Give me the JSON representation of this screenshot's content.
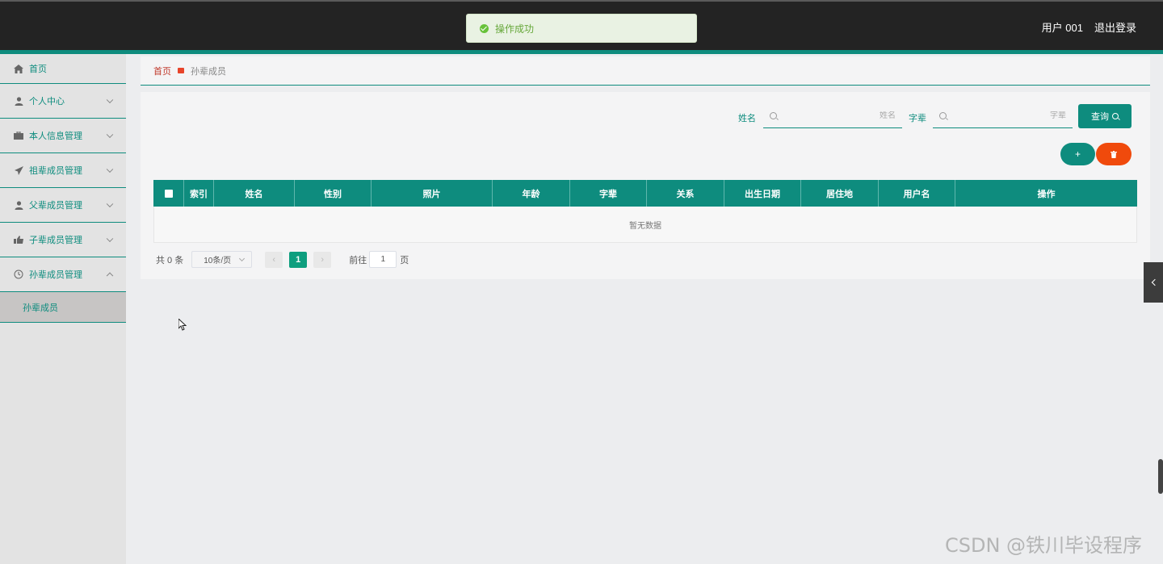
{
  "header": {
    "user_label": "用户 001",
    "logout_label": "退出登录",
    "accent_color": "#0e8c7e"
  },
  "toast": {
    "message": "操作成功",
    "icon": "check-circle-icon",
    "color": "#67c23a"
  },
  "sidebar": {
    "items": [
      {
        "label": "首页",
        "icon": "home-icon"
      },
      {
        "label": "个人中心",
        "icon": "user-icon"
      },
      {
        "label": "本人信息管理",
        "icon": "briefcase-icon"
      },
      {
        "label": "祖辈成员管理",
        "icon": "send-icon"
      },
      {
        "label": "父辈成员管理",
        "icon": "user-icon"
      },
      {
        "label": "子辈成员管理",
        "icon": "thumbs-up-icon"
      },
      {
        "label": "孙辈成员管理",
        "icon": "clock-icon"
      }
    ],
    "active_sub": {
      "label": "孙辈成员"
    }
  },
  "breadcrumb": {
    "home": "首页",
    "current": "孙辈成员"
  },
  "search": {
    "name_label": "姓名",
    "name_placeholder": "姓名",
    "zibei_label": "字辈",
    "zibei_placeholder": "字辈",
    "query_label": "查询"
  },
  "actions": {
    "add_label": "+",
    "delete_icon": "trash-icon"
  },
  "table": {
    "columns": [
      "索引",
      "姓名",
      "性别",
      "照片",
      "年龄",
      "字辈",
      "关系",
      "出生日期",
      "居住地",
      "用户名",
      "操作"
    ],
    "empty_text": "暂无数据"
  },
  "pagination": {
    "total_text": "共 0 条",
    "page_size": "10条/页",
    "current_page": "1",
    "goto_label": "前往",
    "goto_value": "1",
    "page_suffix": "页"
  },
  "watermark": "CSDN @铁川毕设程序"
}
